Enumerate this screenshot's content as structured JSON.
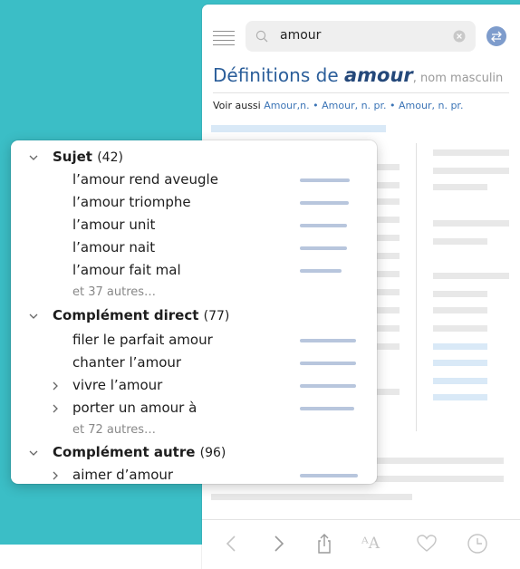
{
  "search": {
    "query": "amour"
  },
  "definition": {
    "title_lead": "Définitions de ",
    "title_word": "amour",
    "title_pos": ", nom masculin",
    "see_also_label": "Voir aussi ",
    "see_also_links": [
      "Amour,n.",
      "Amour, n. pr.",
      "Amour, n. pr."
    ],
    "separator": " • "
  },
  "popover": {
    "groups": [
      {
        "name": "Sujet",
        "count": "(42)",
        "expanded": true,
        "items": [
          {
            "label": "l’amour rend aveugle",
            "strength": 0.76,
            "expandable": false
          },
          {
            "label": "l’amour triomphe",
            "strength": 0.74,
            "expandable": false
          },
          {
            "label": "l’amour unit",
            "strength": 0.72,
            "expandable": false
          },
          {
            "label": "l’amour nait",
            "strength": 0.72,
            "expandable": false
          },
          {
            "label": "l’amour fait mal",
            "strength": 0.62,
            "expandable": false
          }
        ],
        "more": "et 37 autres…"
      },
      {
        "name": "Complément direct",
        "count": "(77)",
        "expanded": true,
        "items": [
          {
            "label": "filer le parfait amour",
            "strength": 0.86,
            "expandable": false
          },
          {
            "label": "chanter l’amour",
            "strength": 0.86,
            "expandable": false
          },
          {
            "label": "vivre l’amour",
            "strength": 0.86,
            "expandable": true
          },
          {
            "label": "porter un amour à",
            "strength": 0.84,
            "expandable": true
          }
        ],
        "more": "et 72 autres…"
      },
      {
        "name": "Complément autre",
        "count": "(96)",
        "expanded": true,
        "items": [
          {
            "label": "aimer d’amour",
            "strength": 0.9,
            "expandable": true
          }
        ],
        "more": ""
      }
    ]
  },
  "colors": {
    "teal_background": "#3bbec6",
    "title_blue": "#2b5e9a",
    "link_blue": "#3b74b6",
    "strength_bar": "#b8c6dd"
  },
  "toolbar_icons": [
    "back-icon",
    "forward-icon",
    "share-icon",
    "text-size-icon",
    "favorite-icon",
    "history-icon"
  ],
  "toolbar": {
    "text_size_glyph": "ᴬA"
  }
}
